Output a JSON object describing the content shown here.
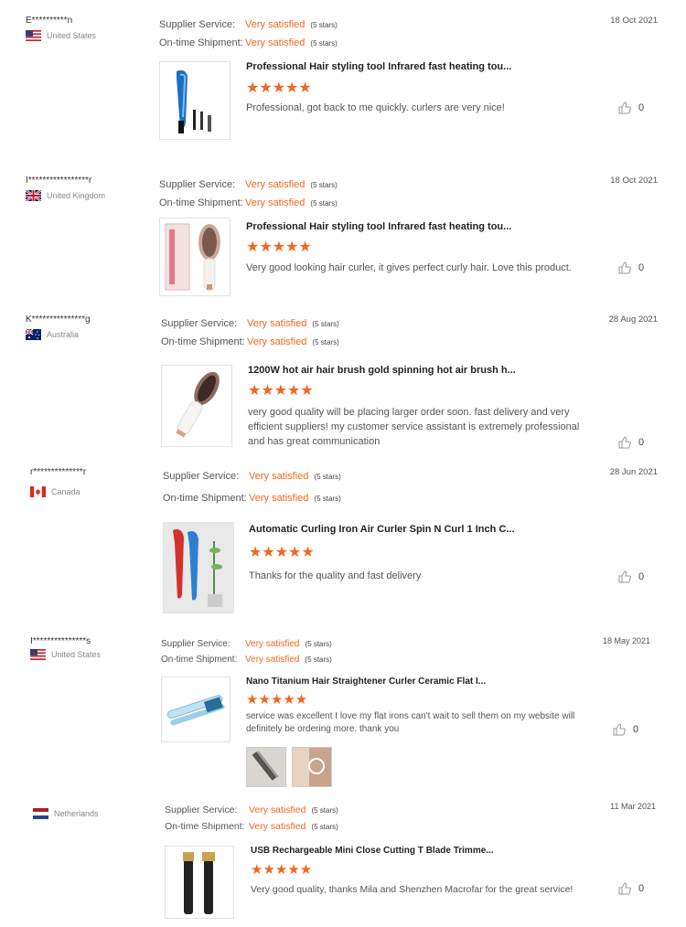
{
  "labels": {
    "supplier": "Supplier Service:",
    "shipment": "On-time Shipment:"
  },
  "reviews": [
    {
      "buyer": "E**********n",
      "country": "United States",
      "flag": "us-flag",
      "supplier_value": "Very satisfied",
      "supplier_stars": "(5 stars)",
      "shipment_value": "Very satisfied",
      "shipment_stars": "(5 stars)",
      "date": "18 Oct 2021",
      "product_title": "Professional Hair styling tool Infrared fast heating tou...",
      "product_icon": "blue-hair-curler-product-image",
      "stars": "★★★★★",
      "comment": "Professional, got back to me quickly. curlers are very nice!",
      "likes": "0"
    },
    {
      "buyer": "I*****************r",
      "country": "United Kingdom",
      "flag": "uk-flag",
      "supplier_value": "Very satisfied",
      "supplier_stars": "(5 stars)",
      "shipment_value": "Very satisfied",
      "shipment_stars": "(5 stars)",
      "date": "18 Oct 2021",
      "product_title": "Professional Hair styling tool Infrared fast heating tou...",
      "product_icon": "round-brush-with-box-product-image",
      "stars": "★★★★★",
      "comment": "Very good looking hair curler, it gives perfect curly hair.  Love this product.",
      "likes": "0"
    },
    {
      "buyer": "K***************g",
      "country": "Australia",
      "flag": "australia-flag",
      "supplier_value": "Very satisfied",
      "supplier_stars": "(5 stars)",
      "shipment_value": "Very satisfied",
      "shipment_stars": "(5 stars)",
      "date": "28 Aug 2021",
      "product_title": "1200W hot air hair brush gold spinning hot air brush h...",
      "product_icon": "hot-air-brush-product-image",
      "stars": "★★★★★",
      "comment": "very good quality will be placing larger order soon. fast delivery and very efficient suppliers! my customer service assistant is extremely professional and has great communication",
      "likes": "0"
    },
    {
      "buyer": "r**************r",
      "country": "Canada",
      "flag": "canada-flag",
      "supplier_value": "Very satisfied",
      "supplier_stars": "(5 stars)",
      "shipment_value": "Very satisfied",
      "shipment_stars": "(5 stars)",
      "date": "28 Jun 2021",
      "product_title": "Automatic Curling Iron Air Curler Spin N Curl 1 Inch C...",
      "product_icon": "red-blue-curling-iron-product-image",
      "stars": "★★★★★",
      "comment": "Thanks for the quality and fast delivery",
      "likes": "0"
    },
    {
      "buyer": "I***************s",
      "country": "United States",
      "flag": "us-flag",
      "supplier_value": "Very satisfied",
      "supplier_stars": "(5 stars)",
      "shipment_value": "Very satisfied",
      "shipment_stars": "(5 stars)",
      "date": "18 May 2021",
      "product_title": "Nano Titanium Hair Straightener Curler Ceramic Flat I...",
      "product_icon": "flat-iron-product-image",
      "stars": "★★★★★",
      "comment": "service was excellent I love my flat irons can't wait to sell them on my website will definitely be ordering more. thank you",
      "likes": "0"
    },
    {
      "buyer": "",
      "country": "Netherlands",
      "flag": "netherlands-flag",
      "supplier_value": "Very satisfied",
      "supplier_stars": "(5 stars)",
      "shipment_value": "Very satisfied",
      "shipment_stars": "(5 stars)",
      "date": "11 Mar 2021",
      "product_title": "USB Rechargeable Mini Close Cutting T Blade Trimme...",
      "product_icon": "t-blade-trimmer-product-image",
      "stars": "★★★★★",
      "comment": "Very good quality, thanks Mila and Shenzhen Macrofar for the great service!",
      "likes": "0"
    }
  ],
  "colors": {
    "accent": "#f2671f",
    "text": "#333333",
    "muted": "#888888"
  }
}
